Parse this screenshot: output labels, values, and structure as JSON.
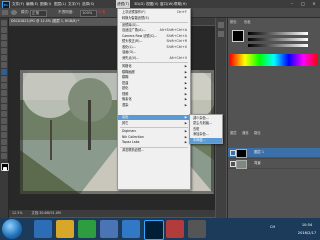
{
  "app": {
    "logo": "Ps"
  },
  "menubar": {
    "items": [
      "文件(F)",
      "编辑(E)",
      "图像(I)",
      "图层(L)",
      "文字(Y)",
      "选择(S)",
      "滤镜(T)",
      "3D(D)",
      "视图(V)",
      "窗口(W)",
      "帮助(H)"
    ],
    "active_index": 6
  },
  "window_controls": {
    "minimize": "–",
    "maximize": "□",
    "close": "×"
  },
  "options_bar": {
    "mode_label": "模式:",
    "mode_value": "正常",
    "size_label": "不透明度:",
    "size_value": "100%",
    "preset": "平滑"
  },
  "document_tab": {
    "label": "DSC01823.JPG @ 12.5% (图层 1, RGB/8) *"
  },
  "status_bar": {
    "zoom": "12.5%",
    "doc_info": "文档:30.6M/31.0M"
  },
  "filter_menu": {
    "items": [
      {
        "label": "上次滤镜操作(F)",
        "shortcut": "Ctrl+F"
      },
      {
        "label": "转换为智能滤镜(S)",
        "shortcut": ""
      },
      {
        "separator": true
      },
      {
        "label": "滤镜库(G)...",
        "shortcut": ""
      },
      {
        "label": "自适应广角(A)...",
        "shortcut": "Alt+Shift+Ctrl+A"
      },
      {
        "label": "Camera Raw 滤镜(C)...",
        "shortcut": "Shift+Ctrl+A"
      },
      {
        "label": "镜头校正(R)...",
        "shortcut": "Shift+Ctrl+R"
      },
      {
        "label": "液化(L)...",
        "shortcut": "Shift+Ctrl+X"
      },
      {
        "label": "油画(O)...",
        "shortcut": ""
      },
      {
        "label": "消失点(V)...",
        "shortcut": "Alt+Ctrl+V"
      },
      {
        "separator": true
      },
      {
        "label": "风格化",
        "submenu": true
      },
      {
        "label": "模糊画廊",
        "submenu": true
      },
      {
        "label": "模糊",
        "submenu": true
      },
      {
        "label": "扭曲",
        "submenu": true
      },
      {
        "label": "锐化",
        "submenu": true
      },
      {
        "label": "视频",
        "submenu": true
      },
      {
        "label": "像素化",
        "submenu": true
      },
      {
        "label": "渲染",
        "submenu": true
      },
      {
        "label": "杂色",
        "submenu": true,
        "highlighted": true
      },
      {
        "label": "其它",
        "submenu": true
      },
      {
        "separator": true
      },
      {
        "label": "Digimarc",
        "submenu": true
      },
      {
        "label": "Nik Collection",
        "submenu": true
      },
      {
        "label": "Topaz Labs",
        "submenu": true
      },
      {
        "separator": true
      },
      {
        "label": "浏览联机滤镜...",
        "shortcut": ""
      }
    ]
  },
  "noise_submenu": {
    "items": [
      {
        "label": "减少杂色..."
      },
      {
        "label": "蒙尘与划痕..."
      },
      {
        "label": "去斑"
      },
      {
        "label": "添加杂色..."
      },
      {
        "label": "中间值...",
        "highlighted": true
      }
    ]
  },
  "panels": {
    "tabs": [
      "颜色",
      "色板"
    ],
    "layers_tabs": [
      "图层",
      "通道",
      "路径"
    ],
    "layers": [
      {
        "name": "图层 1",
        "selected": true
      },
      {
        "name": "背景",
        "selected": false
      }
    ]
  },
  "taskbar": {
    "language": "CH",
    "time": "10:54",
    "date": "2016/2/17"
  },
  "colors": {
    "accent": "#5b9bd5",
    "highlight_layer": "#3a6fa8"
  }
}
